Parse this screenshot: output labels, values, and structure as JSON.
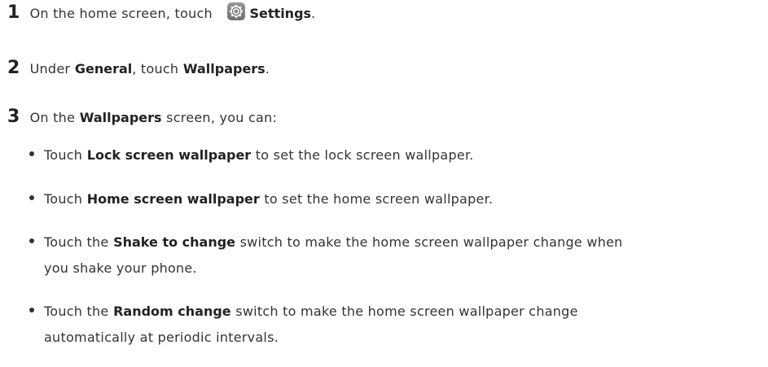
{
  "steps": [
    {
      "number": "1",
      "pre": "On the home screen, touch",
      "icon": "settings-gear-icon",
      "bold": "Settings",
      "post": "."
    },
    {
      "number": "2",
      "pre": "Under",
      "bold1": "General",
      "mid": ", touch",
      "bold2": "Wallpapers",
      "post": "."
    },
    {
      "number": "3",
      "pre": "On the",
      "bold": "Wallpapers",
      "post": "screen, you can:"
    }
  ],
  "bullets": [
    {
      "pre": "Touch",
      "bold": "Lock screen wallpaper",
      "post": "to set the lock screen wallpaper."
    },
    {
      "pre": "Touch",
      "bold": "Home screen wallpaper",
      "post": "to set the home screen wallpaper."
    },
    {
      "pre": "Touch the",
      "bold": "Shake to change",
      "post": "switch to make the home screen wallpaper change when",
      "cont": "you shake your phone."
    },
    {
      "pre": "Touch the",
      "bold": "Random change",
      "post": "switch to make the home screen wallpaper change",
      "cont": "automatically at periodic intervals."
    }
  ]
}
